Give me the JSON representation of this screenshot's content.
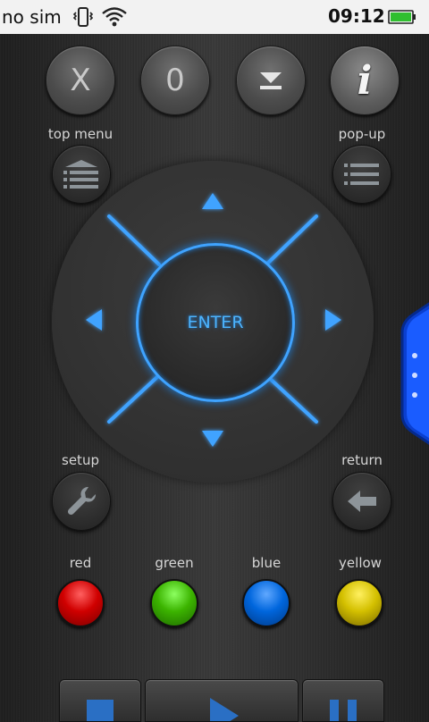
{
  "status_bar": {
    "carrier": "no sim",
    "time": "09:12",
    "icons": [
      "vibrate-icon",
      "wifi-icon",
      "battery-icon"
    ],
    "battery_color": "#2fbf2f"
  },
  "top_buttons": {
    "x_label": "X",
    "zero_label": "0",
    "eject_icon": "eject-icon",
    "info_label": "i"
  },
  "menu": {
    "top_menu_label": "top menu",
    "popup_label": "pop-up",
    "setup_label": "setup",
    "return_label": "return"
  },
  "dpad": {
    "enter_label": "ENTER",
    "accent_color": "#3fa3ff"
  },
  "color_buttons": {
    "red": "red",
    "green": "green",
    "blue": "blue",
    "yellow": "yellow"
  },
  "transport": {
    "icons": [
      "stop-icon",
      "play-icon",
      "pause-icon"
    ]
  }
}
